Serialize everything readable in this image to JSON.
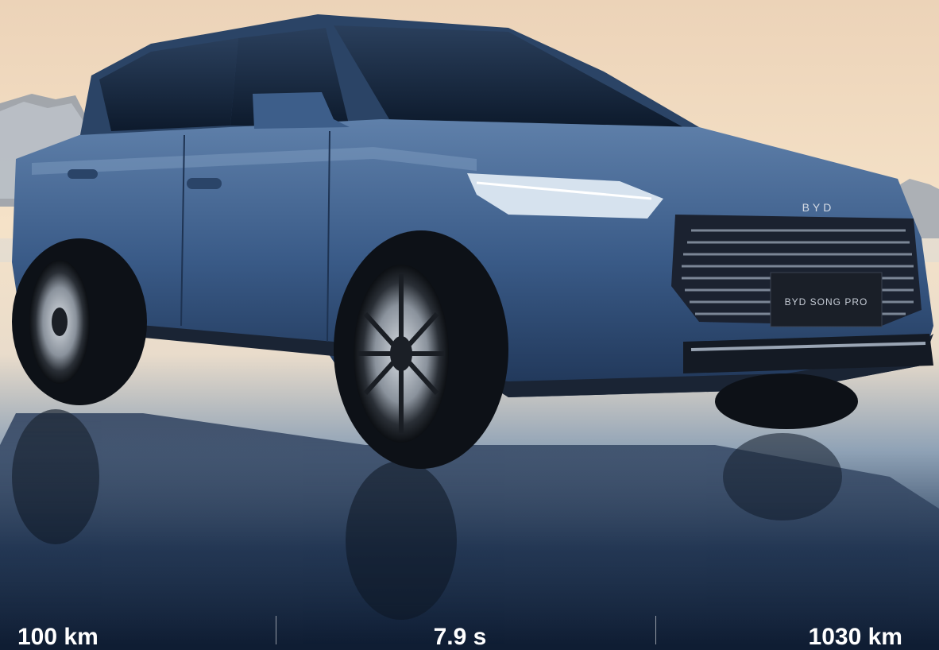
{
  "badge": {
    "brand": "BYD",
    "plate": "BYD SONG PRO"
  },
  "stats": [
    {
      "value": "100 km"
    },
    {
      "value": "7.9 s"
    },
    {
      "value": "1030 km"
    }
  ],
  "colors": {
    "sky_top": "#f1dcc1",
    "sky_bottom": "#f7e6cf",
    "body_blue": "#3c5f8d",
    "dark_bottom": "#132340"
  }
}
